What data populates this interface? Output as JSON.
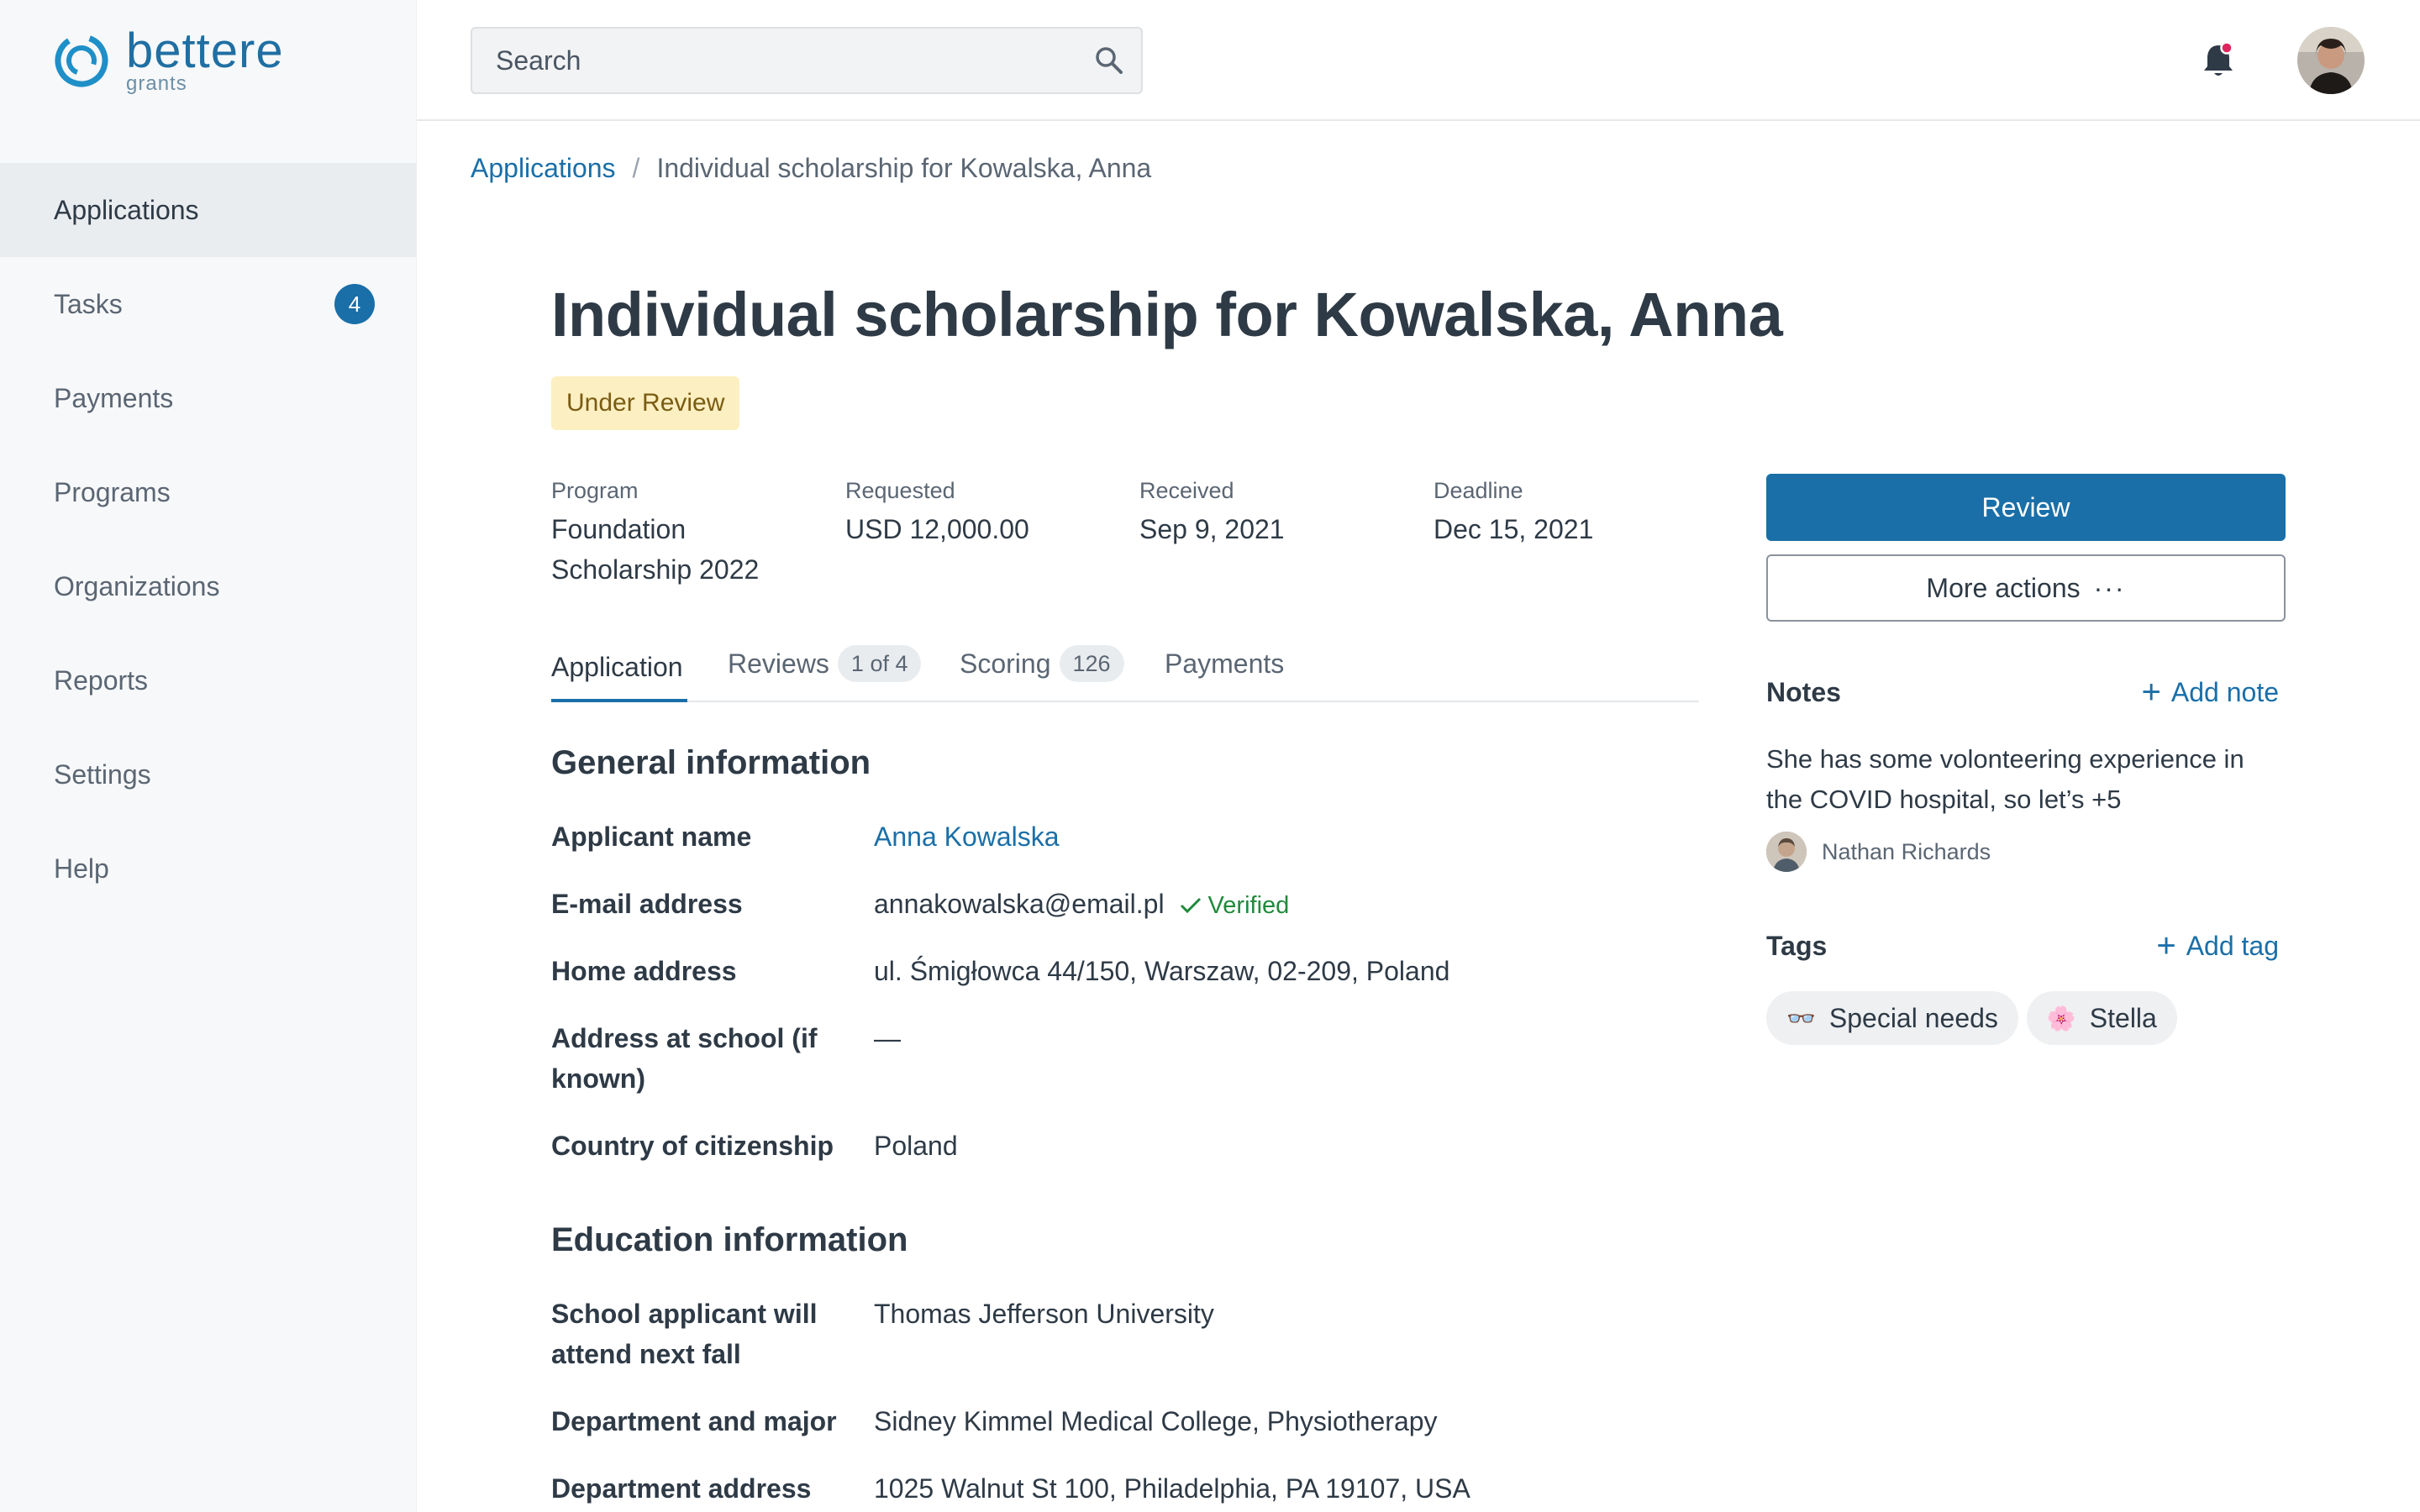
{
  "app": {
    "logo_name": "bettere",
    "logo_sub": "grants"
  },
  "sidebar": {
    "items": [
      {
        "label": "Applications",
        "active": true
      },
      {
        "label": "Tasks",
        "badge": "4"
      },
      {
        "label": "Payments"
      },
      {
        "label": "Programs"
      },
      {
        "label": "Organizations"
      },
      {
        "label": "Reports"
      },
      {
        "label": "Settings"
      },
      {
        "label": "Help"
      }
    ]
  },
  "header": {
    "search_placeholder": "Search",
    "notification_dot_color": "#e0245e"
  },
  "breadcrumb": {
    "root": "Applications",
    "separator": "/",
    "current": "Individual scholarship for Kowalska, Anna"
  },
  "application": {
    "title": "Individual scholarship for Kowalska, Anna",
    "status": "Under Review",
    "meta": [
      {
        "label": "Program",
        "value": "Foundation Scholarship 2022"
      },
      {
        "label": "Requested",
        "value": "USD 12,000.00"
      },
      {
        "label": "Received",
        "value": "Sep 9, 2021"
      },
      {
        "label": "Deadline",
        "value": "Dec 15, 2021"
      }
    ]
  },
  "tabs": [
    {
      "label": "Application",
      "active": true
    },
    {
      "label": "Reviews",
      "count": "1 of 4"
    },
    {
      "label": "Scoring",
      "count": "126"
    },
    {
      "label": "Payments"
    }
  ],
  "general": {
    "title": "General information",
    "fields": [
      {
        "label": "Applicant name",
        "value": "Anna Kowalska"
      },
      {
        "label": "E-mail address",
        "value": "annakowalska@email.pl",
        "verified": "Verified"
      },
      {
        "label": "Home address",
        "value": "ul. Śmigłowca 44/150, Warszaw, 02-209, Poland"
      },
      {
        "label": "Address at school (if known)",
        "value": "—"
      },
      {
        "label": "Country of citizenship",
        "value": "Poland"
      }
    ]
  },
  "education": {
    "title": "Education information",
    "fields": [
      {
        "label": "School applicant will attend next fall",
        "value": "Thomas Jefferson University"
      },
      {
        "label": "Department and major",
        "value": "Sidney Kimmel Medical College, Physiotherapy"
      },
      {
        "label": "Department address",
        "value": "1025 Walnut St 100, Philadelphia, PA 19107, USA"
      }
    ]
  },
  "actions": {
    "review": "Review",
    "more": "More actions",
    "more_icon": "···"
  },
  "notes": {
    "title": "Notes",
    "add": "Add note",
    "text": "She has some volonteering experience in the COVID hospital, so let’s +5",
    "author": "Nathan Richards"
  },
  "tags": {
    "title": "Tags",
    "add": "Add tag",
    "items": [
      {
        "icon": "👓",
        "label": "Special needs"
      },
      {
        "icon": "🌸",
        "label": "Stella"
      }
    ]
  },
  "colors": {
    "accent": "#1a6fa8",
    "status_bg": "#fcefc2",
    "verified": "#1f8a3a"
  }
}
